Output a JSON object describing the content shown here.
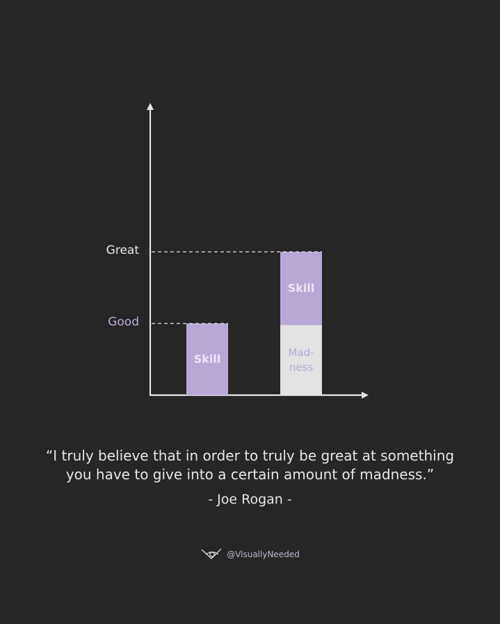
{
  "chart_data": {
    "type": "bar",
    "title": "",
    "xlabel": "",
    "ylabel": "",
    "y_levels": [
      {
        "label": "Great",
        "value": 2,
        "color": "#e6e6e6"
      },
      {
        "label": "Good",
        "value": 1,
        "color": "#b9a8d6"
      }
    ],
    "ylim": [
      0,
      2.3
    ],
    "categories": [
      "",
      ""
    ],
    "bars": [
      {
        "segments": [
          {
            "label": "Skill",
            "value": 1,
            "color": "#b9a8d6",
            "text_color": "#ece6f5"
          }
        ]
      },
      {
        "segments": [
          {
            "label": "Mad-\nness",
            "value": 0.98,
            "color": "#e3e3e3",
            "text_color": "#b9a8d6"
          },
          {
            "label": "Skill",
            "value": 1.02,
            "color": "#b9a8d6",
            "text_color": "#ece6f5"
          }
        ]
      }
    ],
    "axis_color": "#e6e6e6",
    "grid": false
  },
  "quote": {
    "line1": "“I truly believe that in order to truly be great at something",
    "line2": "you have to give into a certain amount of madness.”",
    "author": "- Joe Rogan -"
  },
  "brand": {
    "handle": "@VisuallyNeeded",
    "icon": "eye-logo-icon"
  }
}
